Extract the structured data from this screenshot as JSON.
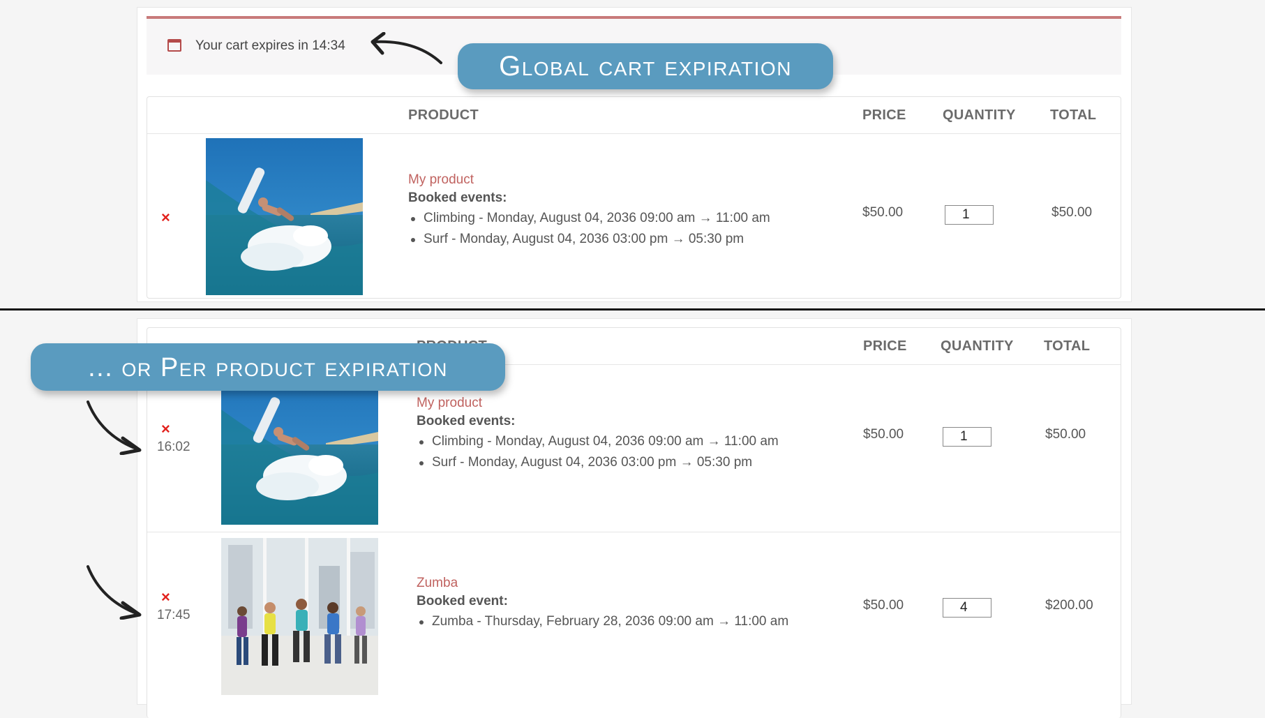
{
  "top": {
    "notice": {
      "text": "Your cart expires in 14:34"
    },
    "headers": {
      "product": "PRODUCT",
      "price": "PRICE",
      "quantity": "QUANTITY",
      "total": "TOTAL"
    },
    "items": [
      {
        "remove": "×",
        "name": "My product",
        "booked_label": "Booked events:",
        "events": [
          "Climbing - Monday, August 04, 2036 09:00 am → 11:00 am",
          "Surf - Monday, August 04, 2036 03:00 pm → 05:30 pm"
        ],
        "price": "$50.00",
        "quantity": "1",
        "total": "$50.00",
        "image": "surf-photo"
      }
    ]
  },
  "bottom": {
    "headers": {
      "product": "PRODUCT",
      "price": "PRICE",
      "quantity": "QUANTITY",
      "total": "TOTAL"
    },
    "items": [
      {
        "remove": "×",
        "timer": "16:02",
        "name": "My product",
        "booked_label": "Booked events:",
        "events": [
          "Climbing - Monday, August 04, 2036 09:00 am → 11:00 am",
          "Surf - Monday, August 04, 2036 03:00 pm → 05:30 pm"
        ],
        "price": "$50.00",
        "quantity": "1",
        "total": "$50.00",
        "image": "surf-photo"
      },
      {
        "remove": "×",
        "timer": "17:45",
        "name": "Zumba",
        "booked_label": "Booked event:",
        "events": [
          "Zumba - Thursday, February 28, 2036 09:00 am → 11:00 am"
        ],
        "price": "$50.00",
        "quantity": "4",
        "total": "$200.00",
        "image": "zumba-photo"
      }
    ]
  },
  "callouts": {
    "global": "Global cart expiration",
    "per_product": "... or Per product expiration"
  },
  "colors": {
    "callout": "#5a9bbf",
    "product_link": "#c0625f",
    "remove": "#e2211c",
    "notice_border": "#c87a7a"
  }
}
